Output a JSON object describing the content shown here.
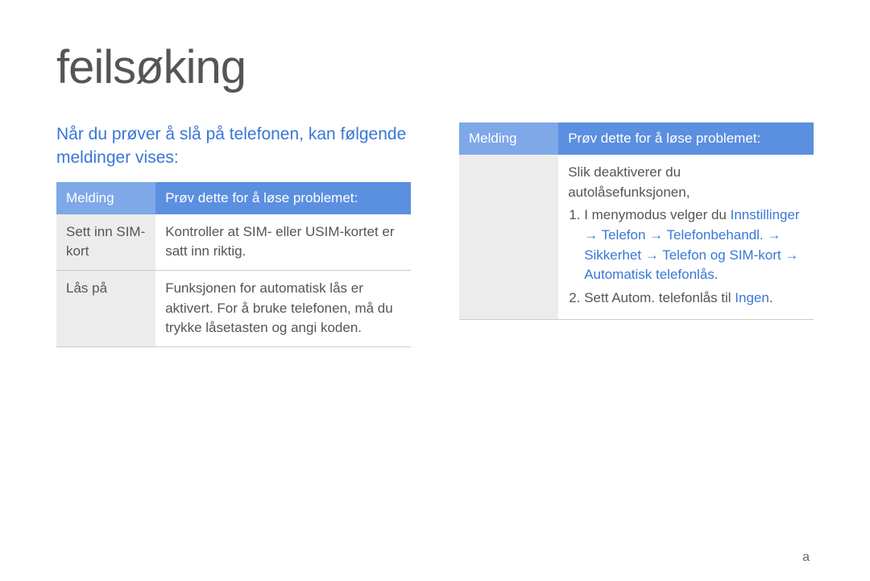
{
  "title": "feilsøking",
  "page_marker": "a",
  "left": {
    "heading": "Når du prøver å slå på telefonen, kan følgende meldinger vises:",
    "header": {
      "col1": "Melding",
      "col2": "Prøv dette for å løse problemet:"
    },
    "rows": [
      {
        "msg": "Sett inn SIM-kort",
        "sol": "Kontroller at SIM- eller USIM-kortet er satt inn riktig."
      },
      {
        "msg": "Lås på",
        "sol": "Funksjonen for automatisk lås er aktivert. For å bruke telefonen, må du trykke låsetasten og angi koden."
      }
    ]
  },
  "right": {
    "header": {
      "col1": "Melding",
      "col2": "Prøv dette for å løse problemet:"
    },
    "row": {
      "msg": "",
      "intro": "Slik deaktiverer du autolåsefunksjonen,",
      "step1_prefix": "I menymodus velger du ",
      "step1_link": "Innstillinger → Telefon → Telefonbehandl. → Sikkerhet → Telefon og SIM-kort → Automatisk telefonlås",
      "step1_suffix": ".",
      "step2_prefix": "Sett Autom. telefonlås til ",
      "step2_link": "Ingen",
      "step2_suffix": "."
    }
  }
}
